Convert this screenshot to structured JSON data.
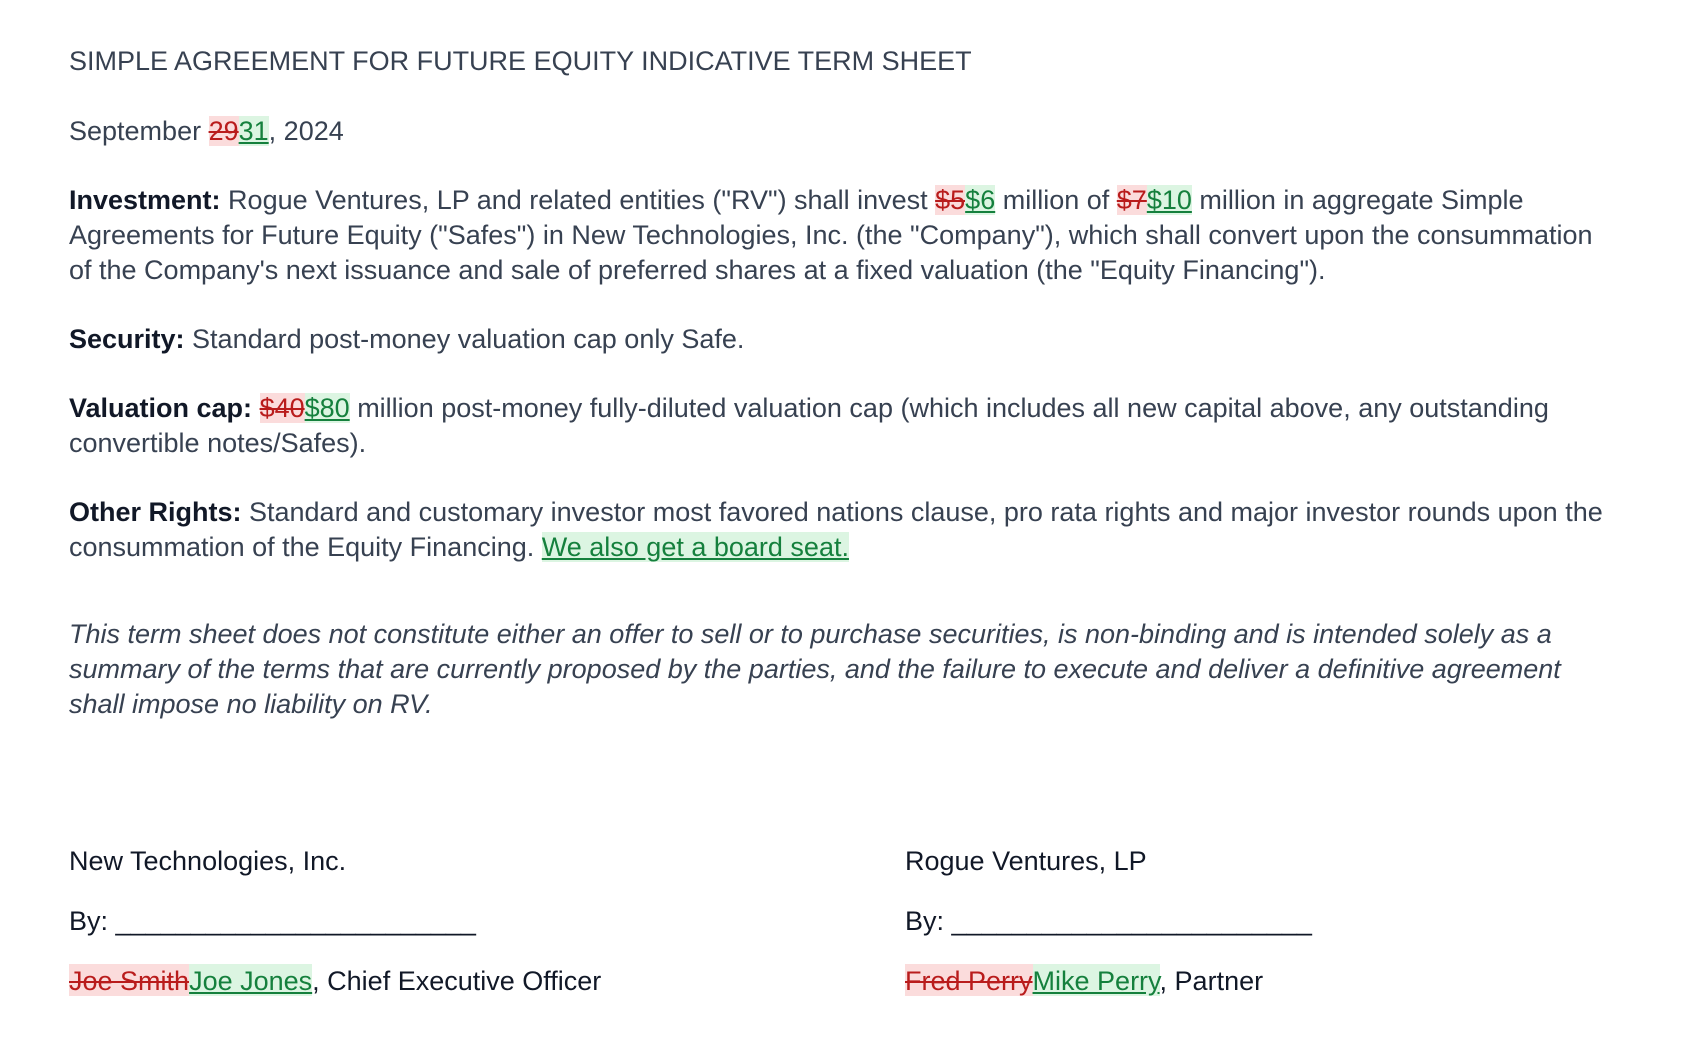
{
  "title": "SIMPLE AGREEMENT FOR FUTURE EQUITY INDICATIVE TERM SHEET",
  "date": {
    "prefix": "September ",
    "deleted": "29",
    "inserted": "31",
    "suffix": ", 2024"
  },
  "investment": {
    "label": "Investment:",
    "text_1": " Rogue Ventures, LP and related entities (\"RV\") shall invest ",
    "amount_deleted": "$5",
    "amount_inserted": "$6",
    "text_2": " million of ",
    "total_deleted": "$7",
    "total_inserted": "$10",
    "text_3": " million in aggregate Simple Agreements for Future Equity (\"Safes\") in New Technologies, Inc. (the \"Company\"), which shall convert upon the consummation of the Company's next issuance and sale of preferred shares at a fixed valuation (the \"Equity Financing\")."
  },
  "security": {
    "label": "Security:",
    "text": " Standard post-money valuation cap only Safe."
  },
  "valuation_cap": {
    "label": "Valuation cap:",
    "deleted": "$40",
    "inserted": "$80",
    "text": " million post-money fully-diluted valuation cap (which includes all new capital above, any outstanding convertible notes/Safes)."
  },
  "other_rights": {
    "label": "Other Rights:",
    "text": " Standard and customary investor most favored nations clause, pro rata rights and major investor rounds upon the consummation of the Equity Financing. ",
    "inserted": "We also get a board seat."
  },
  "disclaimer": "This term sheet does not constitute either an offer to sell or to purchase securities, is non-binding and is intended solely as a summary of the terms that are currently proposed by the parties, and the failure to execute and deliver a definitive agreement shall impose no liability on RV.",
  "signatures": {
    "company": {
      "name": "New Technologies, Inc.",
      "by_line": "By: ________________________",
      "signer_deleted": "Joe Smith",
      "signer_inserted": "Joe Jones",
      "signer_title": ", Chief Executive Officer"
    },
    "investor": {
      "name": "Rogue Ventures, LP",
      "by_line": "By: ________________________",
      "signer_deleted": "Fred Perry",
      "signer_inserted": "Mike Perry",
      "signer_title": ", Partner"
    }
  },
  "colors": {
    "deletion_bg": "#fbdcdc",
    "deletion_text": "#b91c1c",
    "insertion_bg": "#dcf5e2",
    "insertion_text": "#15803d",
    "body_text": "#374151"
  }
}
